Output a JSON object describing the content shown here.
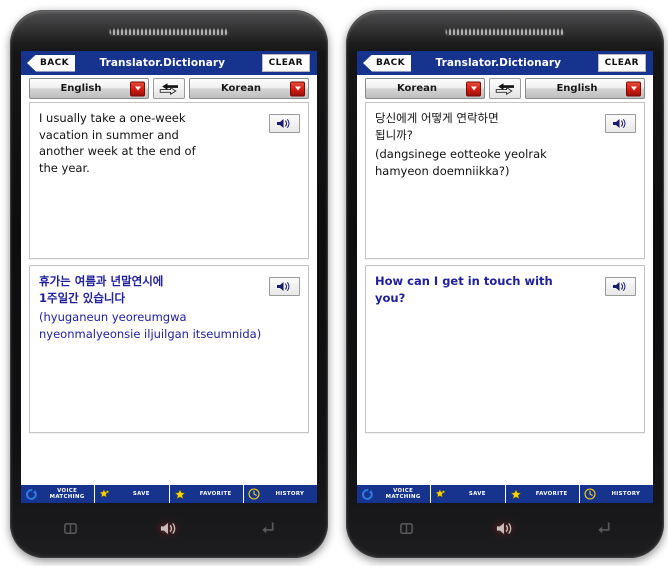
{
  "app": {
    "title": "Translator.Dictionary",
    "back_label": "BACK",
    "clear_label": "CLEAR",
    "header_color": "#16338e",
    "accent_red": "#cf1c12",
    "translation_text_color": "#20209c"
  },
  "toolbar": {
    "items": [
      {
        "icon": "voice-matching-icon",
        "line1": "VOICE",
        "line2": "MATCHING"
      },
      {
        "icon": "save-star-icon",
        "line1": "SAVE",
        "line2": ""
      },
      {
        "icon": "favorite-star-icon",
        "line1": "FAVORITE",
        "line2": ""
      },
      {
        "icon": "history-clock-icon",
        "line1": "HISTORY",
        "line2": ""
      }
    ]
  },
  "softkeys": {
    "menu_label": "menu-icon",
    "home_label": "speaker-home-icon",
    "back_label": "back-arrow-icon"
  },
  "phones": [
    {
      "id": "phone-left",
      "source_lang": "English",
      "target_lang": "Korean",
      "source": {
        "lines": [
          "I usually take a one-week",
          "vacation in summer and",
          "another week at the end of",
          "the year."
        ],
        "romanization": ""
      },
      "target": {
        "lines": [
          "휴가는 여름과 년말연시에",
          "1주일간 있습니다"
        ],
        "romanization": "(hyuganeun yeoreumgwa nyeonmalyeonsie iljuilgan itseumnida)"
      }
    },
    {
      "id": "phone-right",
      "source_lang": "Korean",
      "target_lang": "English",
      "source": {
        "lines": [
          "당신에게 어떻게 연락하면",
          "됩니까?"
        ],
        "romanization": "(dangsinege eotteoke yeolrak hamyeon doemniikka?)"
      },
      "target": {
        "lines": [
          "How can I get in touch with",
          "you?"
        ],
        "romanization": ""
      }
    }
  ]
}
